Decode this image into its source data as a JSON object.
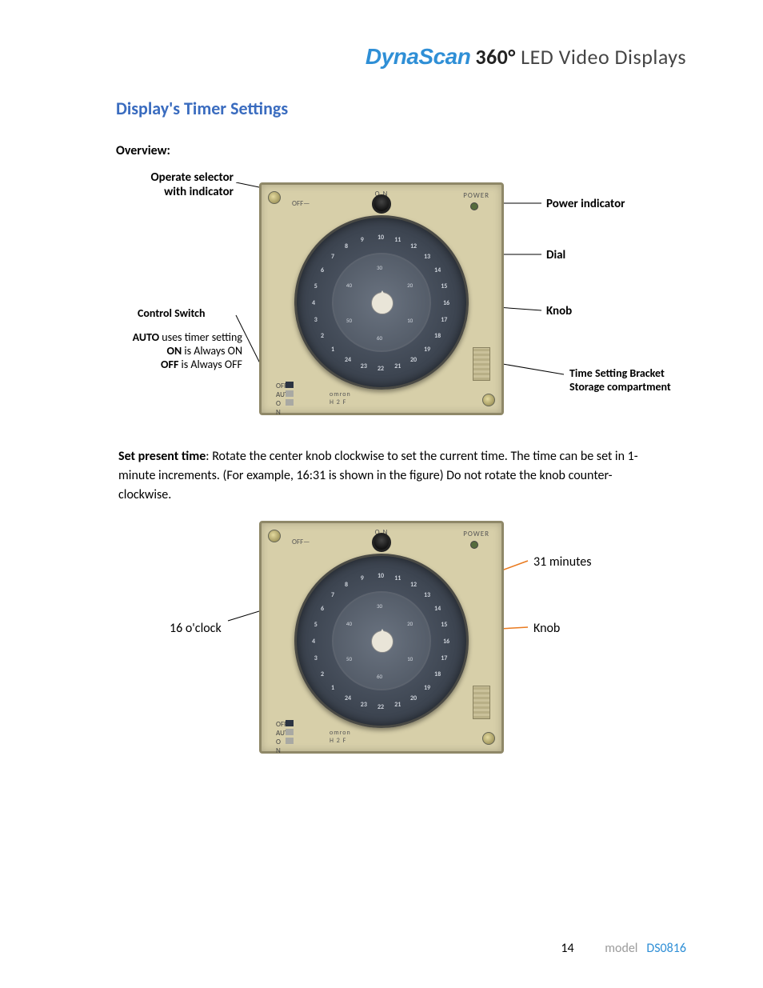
{
  "header": {
    "brand": "DynaScan",
    "product": "360°",
    "tagline": "LED Video Displays"
  },
  "section_title": "Display's Timer Settings",
  "overview_label": "Overview:",
  "fig1": {
    "labels": {
      "operate_selector_l1": "Operate selector",
      "operate_selector_l2": "with indicator",
      "power_indicator": "Power indicator",
      "dial": "Dial",
      "knob": "Knob",
      "control_switch": "Control Switch",
      "auto_b": "AUTO",
      "auto_t": " uses timer setting",
      "on_b": "ON",
      "on_t": " is Always ON",
      "off_b": "OFF",
      "off_t": " is Always OFF",
      "bracket_l1": "Time Setting Bracket",
      "bracket_l2": "Storage compartment"
    },
    "device": {
      "on": "O N",
      "off": "OFF—",
      "power": "POWER",
      "sw_off": "OFF",
      "sw_auto": "AUTO",
      "sw_on": "O N",
      "brand": "omron",
      "model": "H 2 F"
    }
  },
  "dial_hours": [
    "13",
    "14",
    "15",
    "16",
    "17",
    "18",
    "19",
    "20",
    "21",
    "22",
    "23",
    "24",
    "1",
    "2",
    "3",
    "4",
    "5",
    "6",
    "7",
    "8",
    "9",
    "10",
    "11",
    "12"
  ],
  "dial_minutes": [
    "30",
    "20",
    "10",
    "60",
    "50",
    "40"
  ],
  "paragraph": {
    "lead": "Set present time",
    "text": ": Rotate the center knob clockwise to set the current time. The time can be set in 1-minute increments. (For example, 16:31 is shown in the figure) Do not rotate the knob counter-clockwise."
  },
  "fig2": {
    "labels": {
      "minutes": "31 minutes",
      "hours": "16 o'clock",
      "knob": "Knob"
    }
  },
  "footer": {
    "page": "14",
    "model_label": "model",
    "model_no": "DS0816"
  }
}
